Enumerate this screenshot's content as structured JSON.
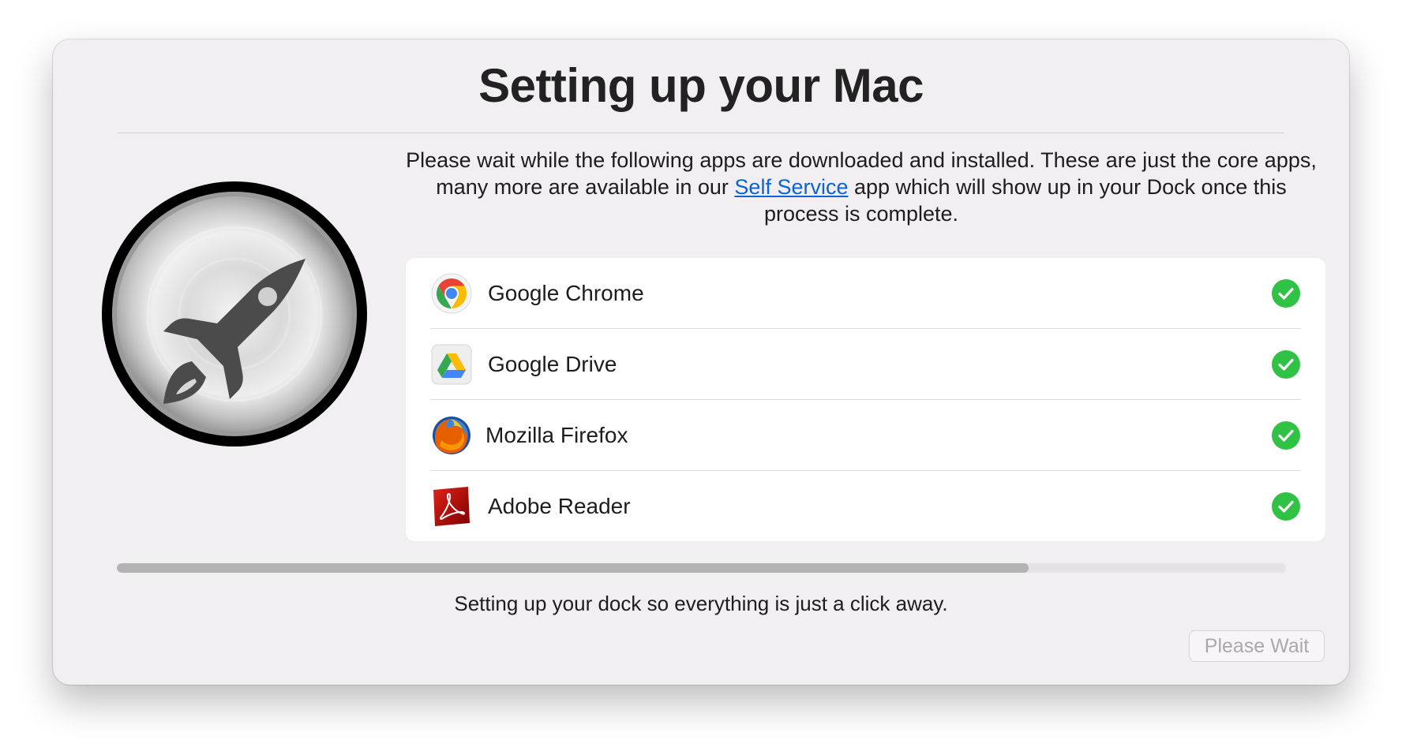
{
  "window": {
    "title": "Setting up your Mac"
  },
  "message": {
    "before_link": "Please wait while the following apps are downloaded and installed. These are just the core apps, many more are available in our ",
    "link_text": "Self Service",
    "after_link": " app which will show up in your Dock once this process is complete."
  },
  "logo": {
    "icon": "rocket-launcher-icon"
  },
  "apps": [
    {
      "name": "Google Chrome",
      "icon": "chrome-icon",
      "status": "installed"
    },
    {
      "name": "Google Drive",
      "icon": "google-drive-icon",
      "status": "installed"
    },
    {
      "name": "Mozilla Firefox",
      "icon": "firefox-icon",
      "status": "installed"
    },
    {
      "name": "Adobe Reader",
      "icon": "adobe-reader-icon",
      "status": "installed"
    }
  ],
  "progress": {
    "fraction": 0.78
  },
  "status_text": "Setting up your dock so everything is just a click away.",
  "button": {
    "label": "Please Wait",
    "enabled": false
  },
  "colors": {
    "window_bg": "#f2eff2",
    "link": "#0a64d4",
    "success_green": "#2fc244",
    "progress_fill": "#b4b3b4"
  }
}
